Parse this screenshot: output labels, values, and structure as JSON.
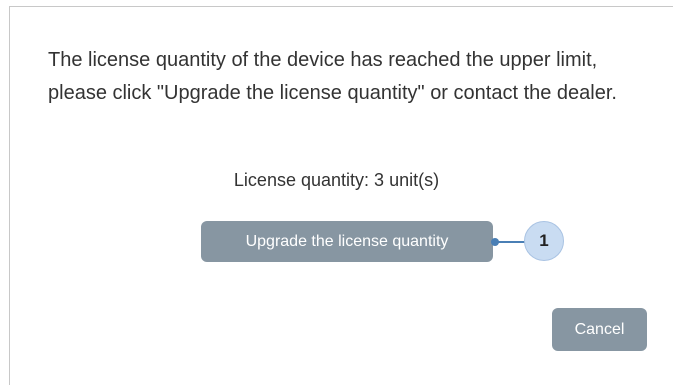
{
  "dialog": {
    "message": "The license quantity of the device has reached the upper limit, please click \"Upgrade the license quantity\" or contact the dealer.",
    "quantity_label": "License quantity:",
    "quantity_value": "3",
    "quantity_unit": "unit(s)",
    "upgrade_button_label": "Upgrade the license quantity",
    "cancel_button_label": "Cancel"
  },
  "annotation": {
    "callout_number": "1"
  },
  "colors": {
    "button_bg": "#8796a2",
    "button_text": "#ffffff",
    "callout_line": "#4a7fb5",
    "callout_badge_bg": "#c9dcf2",
    "text": "#333333"
  }
}
